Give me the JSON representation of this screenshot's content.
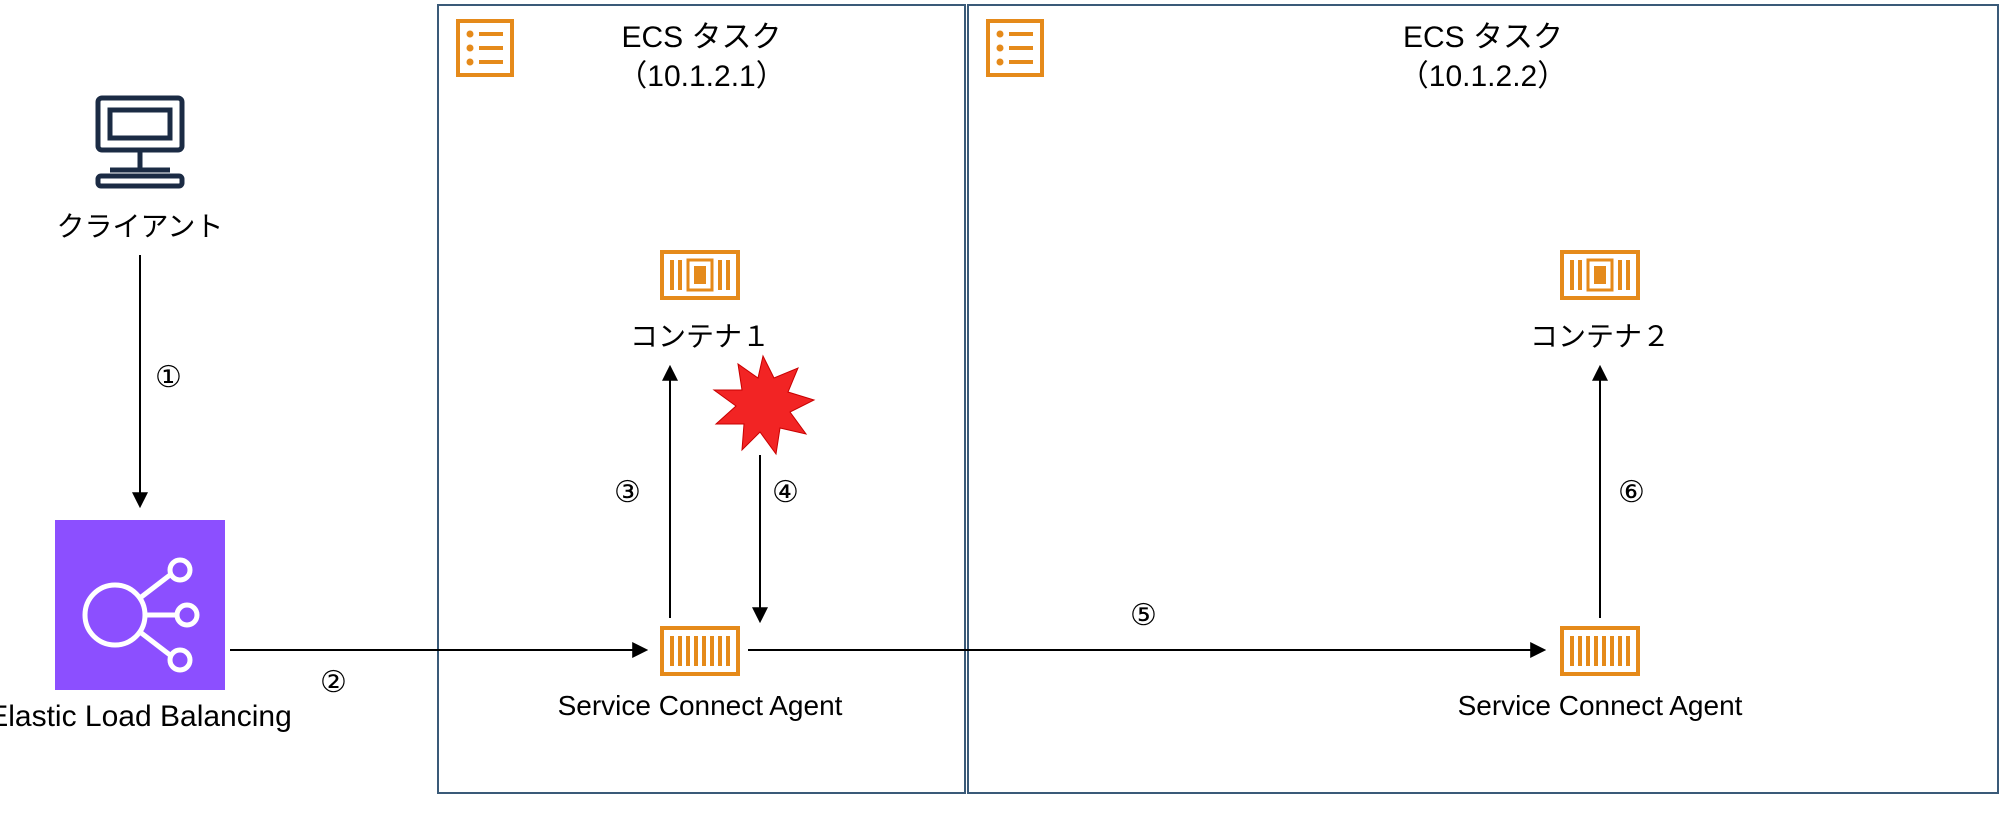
{
  "client_label": "クライアント",
  "elb_label": "Elastic Load Balancing",
  "task1": {
    "title_line1": "ECS タスク",
    "title_line2": "（10.1.2.1）",
    "container_label": "コンテナ１",
    "agent_label": "Service Connect Agent"
  },
  "task2": {
    "title_line1": "ECS タスク",
    "title_line2": "（10.1.2.2）",
    "container_label": "コンテナ２",
    "agent_label": "Service Connect Agent"
  },
  "steps": {
    "s1": "①",
    "s2": "②",
    "s3": "③",
    "s4": "④",
    "s5": "⑤",
    "s6": "⑥"
  },
  "colors": {
    "orange": "#E58A1A",
    "purple": "#8C4FFF",
    "navy": "#1B2B44",
    "red": "#F22424"
  }
}
